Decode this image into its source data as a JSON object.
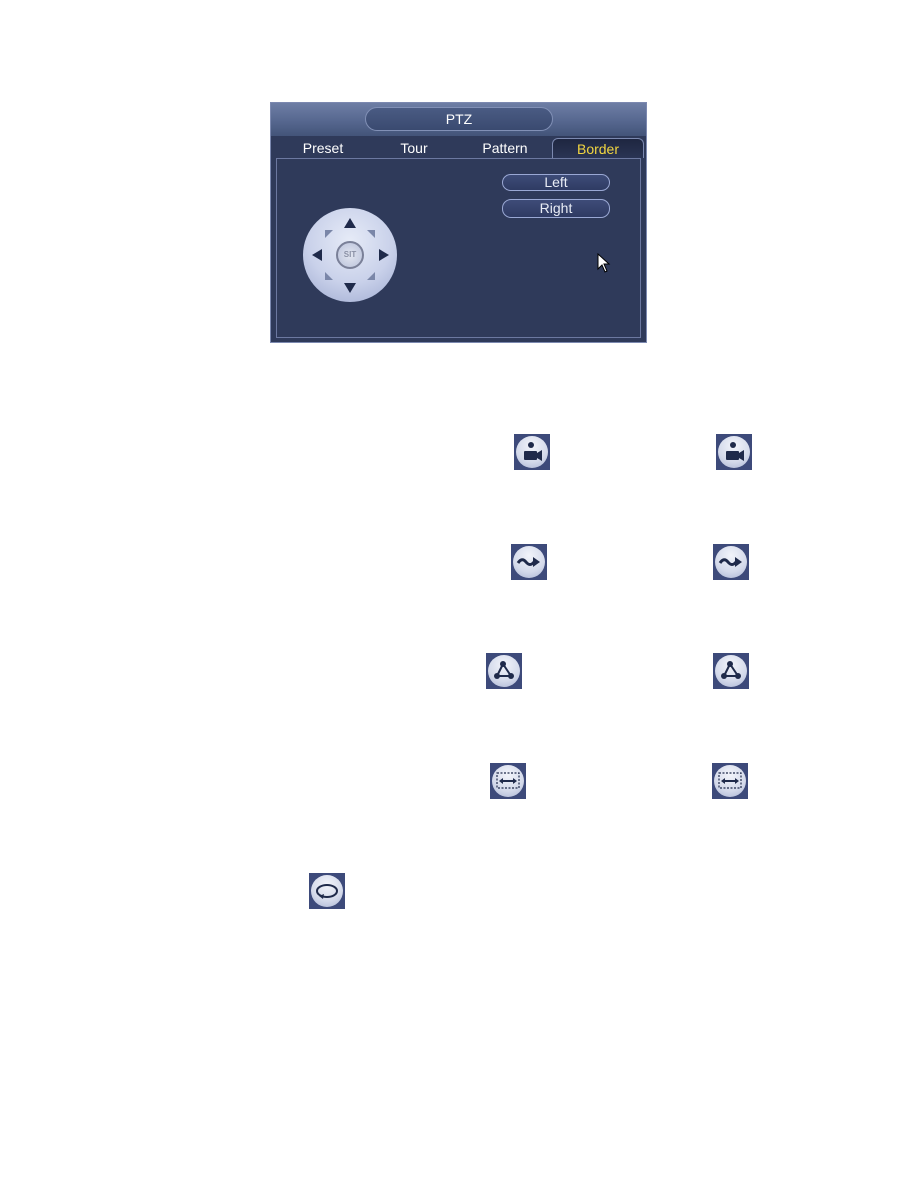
{
  "dialog": {
    "title": "PTZ",
    "tabs": [
      {
        "label": "Preset",
        "active": false
      },
      {
        "label": "Tour",
        "active": false
      },
      {
        "label": "Pattern",
        "active": false
      },
      {
        "label": "Border",
        "active": true
      }
    ],
    "buttons": {
      "left_label": "Left",
      "right_label": "Right"
    },
    "dpad": {
      "center_label": "SIT",
      "directions": [
        "up",
        "down",
        "left",
        "right",
        "up-left",
        "up-right",
        "down-left",
        "down-right"
      ]
    },
    "colors": {
      "background": "#2f3a5a",
      "active_tab_text": "#f2d640",
      "text": "#ffffff"
    }
  },
  "icons": [
    {
      "name": "preset-icon",
      "row": 1,
      "instances": 2
    },
    {
      "name": "tour-icon",
      "row": 2,
      "instances": 2
    },
    {
      "name": "pattern-icon",
      "row": 3,
      "instances": 2
    },
    {
      "name": "border-icon",
      "row": 4,
      "instances": 2
    },
    {
      "name": "rotate-icon",
      "row": 5,
      "instances": 1
    }
  ]
}
